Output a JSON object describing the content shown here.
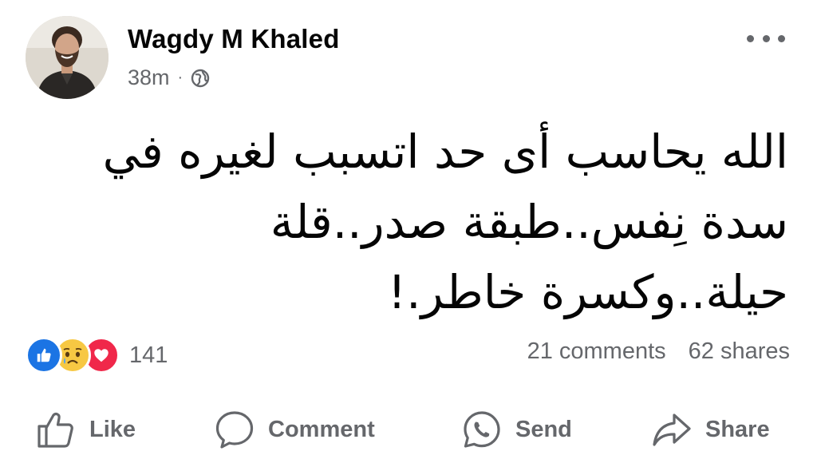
{
  "post": {
    "author": "Wagdy M Khaled",
    "time": "38m",
    "separator": "·",
    "privacy_icon": "globe-icon",
    "text": "الله يحاسب أى حد اتسبب لغيره في\nسدة نِفس..طبقة صدر..قلة\nحيلة..وكسرة خاطر.!",
    "reaction_icons": [
      "like-icon",
      "sad-icon",
      "love-icon"
    ],
    "reaction_count": "141",
    "comments": "21 comments",
    "shares": "62 shares"
  },
  "actions": {
    "like": "Like",
    "comment": "Comment",
    "send": "Send",
    "share": "Share"
  },
  "colors": {
    "like_blue": "#1b74e4",
    "love_red": "#f0284a",
    "sad_yellow": "#f7c843",
    "secondary_text": "#65676b"
  }
}
